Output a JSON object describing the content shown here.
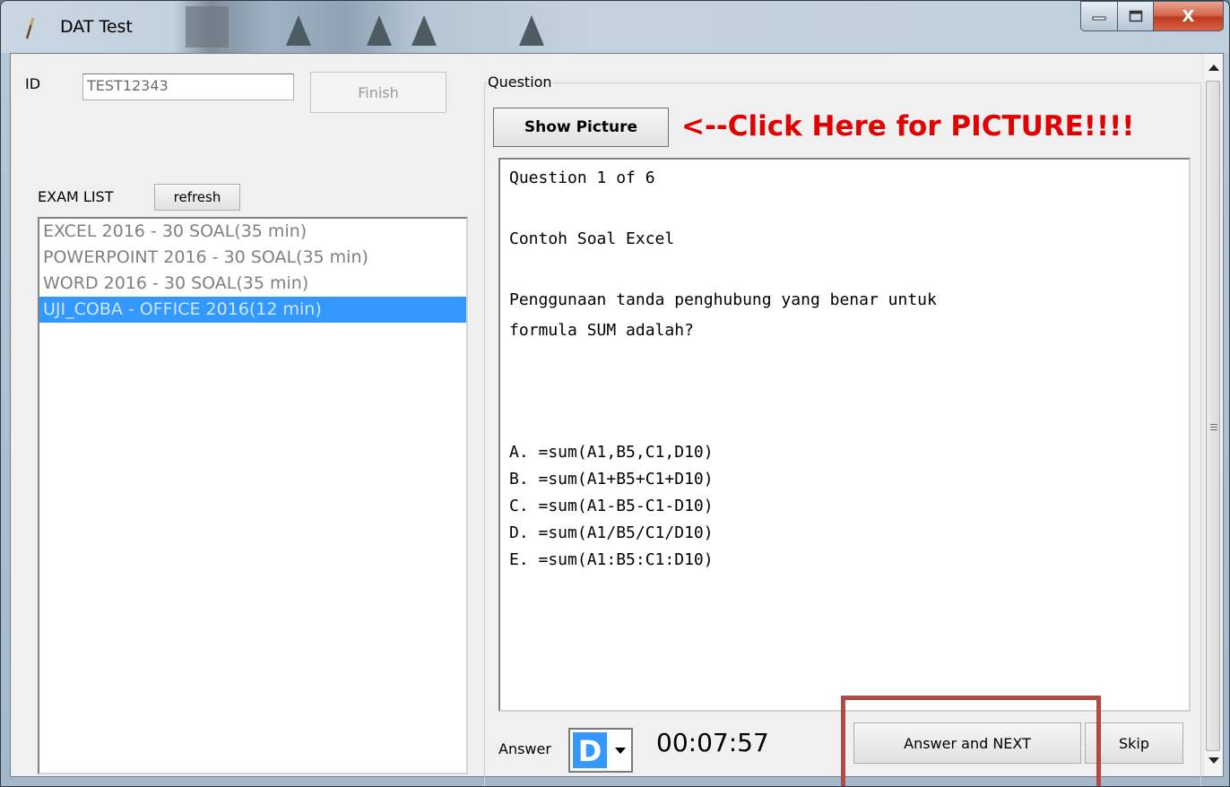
{
  "window": {
    "title": "DAT Test",
    "close_glyph": "X"
  },
  "left_panel": {
    "id_label": "ID",
    "id_value": "TEST12343",
    "finish_label": "Finish",
    "exam_list_label": "EXAM LIST",
    "refresh_label": "refresh",
    "exams": [
      "EXCEL 2016 - 30 SOAL(35 min)",
      "POWERPOINT 2016 - 30 SOAL(35 min)",
      "WORD 2016 - 30 SOAL(35 min)",
      "UJI_COBA - OFFICE 2016(12 min)"
    ],
    "selected_exam_index": 3
  },
  "question_panel": {
    "group_title": "Question",
    "show_picture_label": "Show Picture",
    "hint": "<--Click Here for PICTURE!!!!",
    "hint_color": "#e30000",
    "counter": "Question 1 of 6",
    "subject": "Contoh Soal Excel",
    "question_lines": [
      "Penggunaan tanda penghubung yang benar untuk",
      "formula SUM adalah?"
    ],
    "options": [
      "A. =sum(A1,B5,C1,D10)",
      "B. =sum(A1+B5+C1+D10)",
      "C. =sum(A1-B5-C1-D10)",
      "D. =sum(A1/B5/C1/D10)",
      "E. =sum(A1:B5:C1:D10)"
    ]
  },
  "footer": {
    "answer_label": "Answer",
    "answer_value": "D",
    "timer": "00:07:57",
    "next_label": "Answer and NEXT",
    "skip_label": "Skip"
  },
  "colors": {
    "selection": "#3399ff",
    "highlight_frame": "#b04a48"
  }
}
